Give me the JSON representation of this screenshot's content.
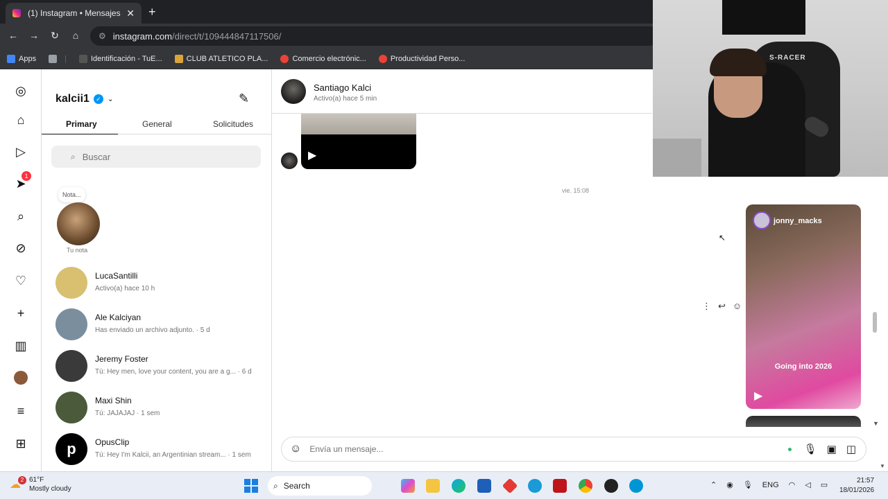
{
  "browser": {
    "tab_title": "(1) Instagram • Mensajes",
    "tab_close": "✕",
    "new_tab": "+",
    "url_host": "instagram.com",
    "url_path": "/direct/t/109444847117506/",
    "bookmarks": [
      {
        "label": "Apps",
        "color": "#4285f4"
      },
      {
        "label": "",
        "color": "#9aa0a6"
      },
      {
        "label": "Identificación - TuE...",
        "color": "#555555"
      },
      {
        "label": "CLUB ATLETICO PLA...",
        "color": "#d9a53a"
      },
      {
        "label": "Comercio electrónic...",
        "color": "#ea4335"
      },
      {
        "label": "Productividad Perso...",
        "color": "#ea4335"
      }
    ]
  },
  "leftnav": {
    "notifications_badge": "1"
  },
  "inbox": {
    "username": "kalcii1",
    "verified_mark": "✓",
    "tabs": [
      "Primary",
      "General",
      "Solicitudes"
    ],
    "search_placeholder": "Buscar",
    "note_bubble": "Nota...",
    "note_label": "Tu nota",
    "conversations": [
      {
        "name": "LucaSantilli",
        "sub": "Activo(a) hace 10 h",
        "color": "#d8c070"
      },
      {
        "name": "Ale Kalciyan",
        "sub": "Has enviado un archivo adjunto. · 5 d",
        "color": "#7a8e9e"
      },
      {
        "name": "Jeremy Foster",
        "sub": "Tú: Hey men, love your content, you are a g... · 6 d",
        "color": "#3a3a3a"
      },
      {
        "name": "Maxi Shin",
        "sub": "Tú: JAJAJAJ · 1 sem",
        "color": "#4a5a3a"
      },
      {
        "name": "OpusClip",
        "sub": "Tú: Hey I'm Kalcii, an Argentinian stream... · 1 sem",
        "color": "#000000"
      }
    ]
  },
  "chat": {
    "contact_name": "Santiago Kalci",
    "contact_status": "Activo(a) hace 5 min",
    "timestamp": "vie. 15:08",
    "reel_user": "jonny_macks",
    "reel_caption": "Going into 2026",
    "composer_placeholder": "Envía un mensaje..."
  },
  "taskbar": {
    "weather_temp": "61°F",
    "weather_desc": "Mostly cloudy",
    "weather_badge": "2",
    "search_label": "Search",
    "language": "ENG",
    "time": "21:57",
    "date": "18/01/2026"
  }
}
